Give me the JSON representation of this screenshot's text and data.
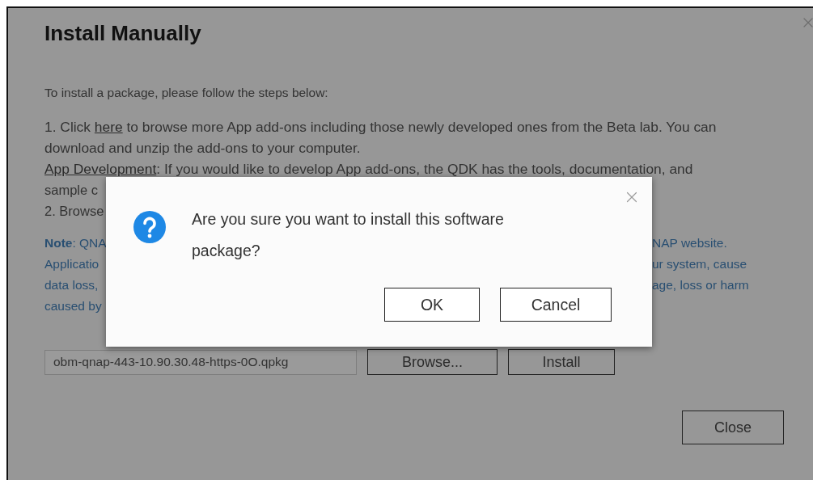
{
  "window": {
    "title": "Install Manually"
  },
  "intro": "To install a package, please follow the steps below:",
  "step_1": {
    "before": "1. Click ",
    "link": "here",
    "after": " to browse more App add-ons including those newly developed ones from the Beta lab. You can download and unzip the add-ons to your computer."
  },
  "app_dev": {
    "link": "App Development",
    "after": ": If you would like to develop App add-ons, the QDK has the tools, documentation, and"
  },
  "partial_rows": [
    {
      "kind": "step",
      "left": "sample c"
    },
    {
      "kind": "step",
      "left": "2. Browse"
    },
    {
      "kind": "note",
      "left": "**Note**: QNA",
      "right": "NAP website."
    },
    {
      "kind": "note",
      "left": "Applicatio",
      "right": "ur system, cause"
    },
    {
      "kind": "note",
      "left": "data loss,",
      "right": "age, loss or harm"
    },
    {
      "kind": "note",
      "left": "caused by"
    }
  ],
  "file_field": {
    "value": "obm-qnap-443-10.90.30.48-https-0O.qpkg"
  },
  "file_buttons": [
    "Browse...",
    "Install"
  ],
  "close_button": "Close",
  "dialog": {
    "message": "Are you sure you want to install this software package?",
    "buttons": [
      "OK",
      "Cancel"
    ]
  }
}
